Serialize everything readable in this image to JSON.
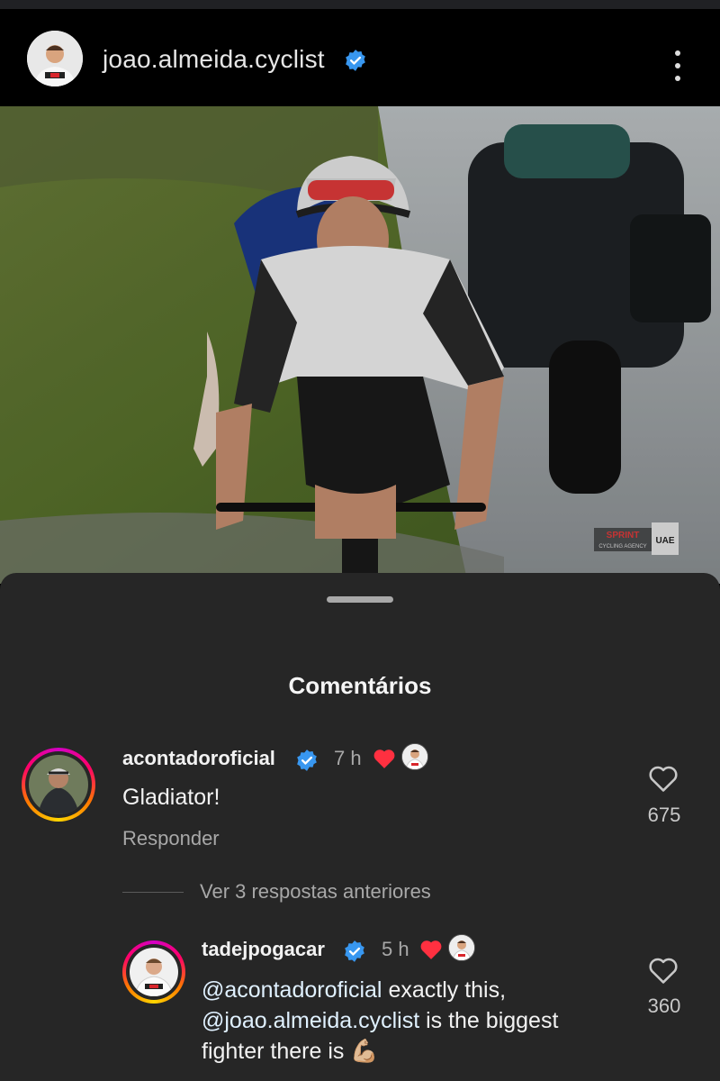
{
  "header": {
    "username": "joao.almeida.cyclist",
    "verified_icon": "verified-badge-icon",
    "menu_icon": "more-vertical-icon"
  },
  "photo": {
    "description_icon": "cyclist-photo",
    "watermark_line1": "SPRINT",
    "watermark_line2": "CYCLING AGENCY",
    "watermark_badge": "UAE"
  },
  "sheet": {
    "title": "Comentários",
    "view_more": "Ver 3 respostas anteriores"
  },
  "comments": [
    {
      "username": "acontadoroficial",
      "time": "7 h",
      "text": "Gladiator!",
      "reply_label": "Responder",
      "likes": "675",
      "liked_by_author": true
    },
    {
      "username": "tadejpogacar",
      "time": "5 h",
      "mention1": "@acontadoroficial",
      "text1": " exactly this,",
      "mention2": "@joao.almeida.cyclist",
      "text2": " is the biggest",
      "text3": "fighter there is 💪🏼",
      "likes": "360",
      "liked_by_author": true
    }
  ],
  "colors": {
    "verified": "#3897f0",
    "heart": "#ff3040",
    "sheet_bg": "#262626"
  }
}
